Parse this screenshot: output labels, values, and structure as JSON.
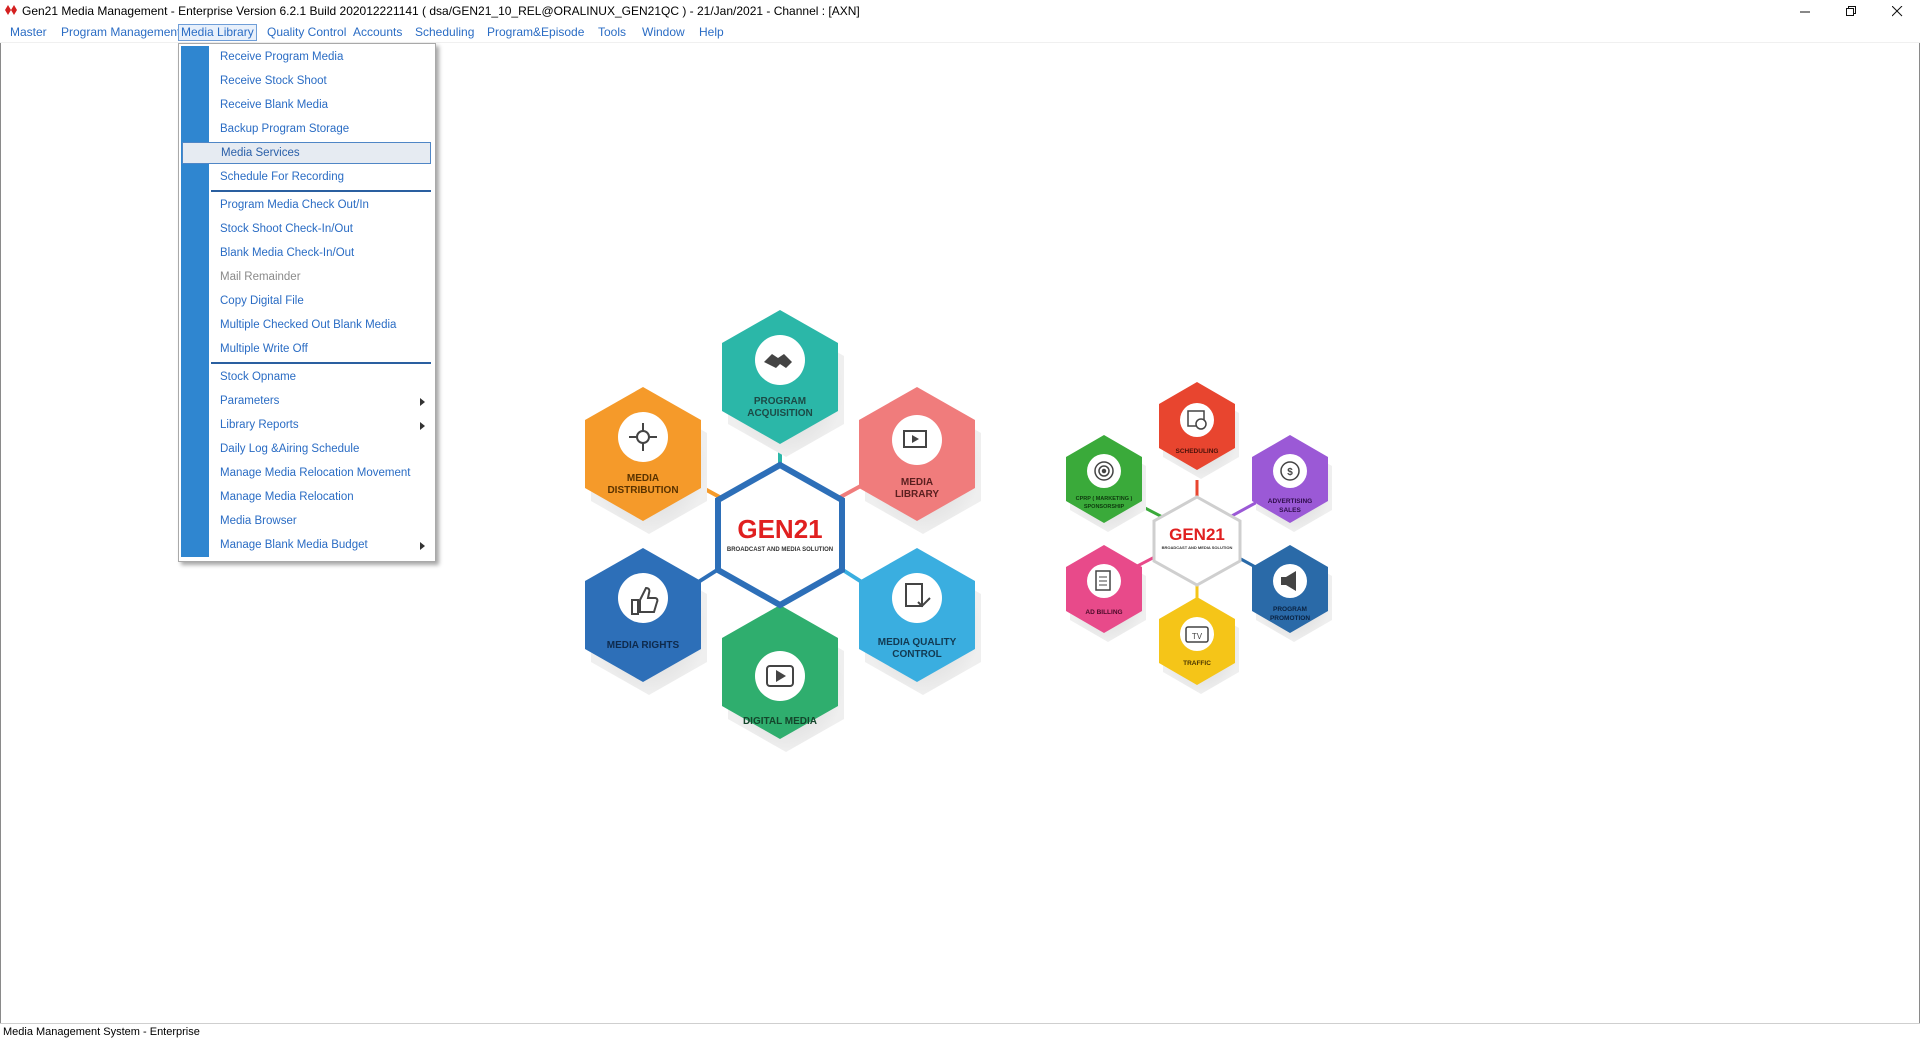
{
  "window": {
    "title": "Gen21 Media Management - Enterprise Version 6.2.1 Build 202012221141 ( dsa/GEN21_10_REL@ORALINUX_GEN21QC ) - 21/Jan/2021 - Channel : [AXN]",
    "minimize_icon": "minimize-icon",
    "restore_icon": "restore-icon",
    "close_icon": "close-icon"
  },
  "menubar": {
    "items": [
      "Master",
      "Program Management",
      "Media Library",
      "Quality Control",
      "Accounts",
      "Scheduling",
      "Program&Episode",
      "Tools",
      "Window",
      "Help"
    ],
    "active": "Media Library"
  },
  "dropdown": {
    "items": [
      {
        "label": "Receive Program Media"
      },
      {
        "label": "Receive Stock Shoot"
      },
      {
        "label": "Receive Blank Media"
      },
      {
        "label": "Backup Program Storage"
      },
      {
        "label": "Media Services",
        "state": "hover"
      },
      {
        "label": "Schedule For Recording"
      },
      {
        "label": "Program Media Check Out/In"
      },
      {
        "label": "Stock Shoot Check-In/Out"
      },
      {
        "label": "Blank Media Check-In/Out"
      },
      {
        "label": "Mail Remainder",
        "state": "disabled"
      },
      {
        "label": "Copy Digital File"
      },
      {
        "label": "Multiple Checked Out Blank Media"
      },
      {
        "label": "Multiple Write Off"
      },
      {
        "label": "Stock Opname"
      },
      {
        "label": "Parameters",
        "submenu": true
      },
      {
        "label": "Library Reports",
        "submenu": true
      },
      {
        "label": "Daily Log &Airing Schedule"
      },
      {
        "label": "Manage Media Relocation Movement"
      },
      {
        "label": "Manage Media Relocation"
      },
      {
        "label": "Media Browser"
      },
      {
        "label": "Manage Blank Media Budget",
        "submenu": true
      }
    ]
  },
  "left_graphic": {
    "center_brand": "GEN21",
    "center_tagline": "BROADCAST AND MEDIA SOLUTION",
    "modules": [
      {
        "line1": "PROGRAM",
        "line2": "ACQUISITION",
        "color": "#2bb7a8",
        "icon": "handshake-icon"
      },
      {
        "line1": "MEDIA",
        "line2": "LIBRARY",
        "color": "#f07c7c",
        "icon": "media-library-icon"
      },
      {
        "line1": "MEDIA QUALITY",
        "line2": "CONTROL",
        "color": "#3aaee0",
        "icon": "document-check-icon"
      },
      {
        "line1": "DIGITAL MEDIA",
        "line2": "",
        "color": "#2fae6e",
        "icon": "play-icon"
      },
      {
        "line1": "MEDIA RIGHTS",
        "line2": "",
        "color": "#2d6fb8",
        "icon": "thumbs-up-icon"
      },
      {
        "line1": "MEDIA",
        "line2": "DISTRIBUTION",
        "color": "#f59a2a",
        "icon": "distribution-icon"
      }
    ]
  },
  "right_graphic": {
    "center_brand": "GEN21",
    "center_tagline": "BROADCAST AND MEDIA SOLUTION",
    "modules": [
      {
        "line1": "SCHEDULING",
        "line2": "",
        "color": "#e8452f",
        "icon": "calendar-icon"
      },
      {
        "line1": "ADVERTISING",
        "line2": "SALES",
        "color": "#9b59d6",
        "icon": "sales-icon"
      },
      {
        "line1": "PROGRAM",
        "line2": "PROMOTION",
        "color": "#2a6aa8",
        "icon": "megaphone-icon"
      },
      {
        "line1": "TRAFFIC",
        "line2": "",
        "color": "#f5c518",
        "icon": "tv-icon"
      },
      {
        "line1": "AD BILLING",
        "line2": "",
        "color": "#e84a8a",
        "icon": "billing-icon"
      },
      {
        "line1": "CPRP ( MARKETING )",
        "line2": "SPONSORSHIP",
        "color": "#3aaa3a",
        "icon": "target-icon"
      }
    ]
  },
  "statusbar": {
    "text": "Media Management System - Enterprise"
  }
}
